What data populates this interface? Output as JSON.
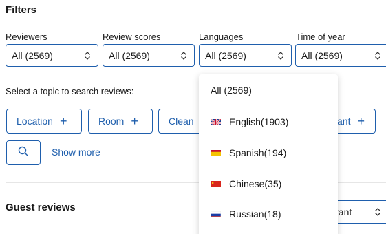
{
  "filters": {
    "title": "Filters",
    "reviewers": {
      "label": "Reviewers",
      "value": "All (2569)"
    },
    "review_scores": {
      "label": "Review scores",
      "value": "All (2569)"
    },
    "languages": {
      "label": "Languages",
      "value": "All (2569)"
    },
    "time_of_year": {
      "label": "Time of year",
      "value": "All (2569)"
    }
  },
  "topics": {
    "prompt": "Select a topic to search reviews:",
    "chips": [
      {
        "label": "Location"
      },
      {
        "label": "Room"
      },
      {
        "label": "Clean"
      },
      {
        "label": "ant"
      }
    ],
    "show_more": "Show more"
  },
  "guest_reviews": {
    "title": "Guest reviews",
    "sort_value": "evant"
  },
  "language_dropdown": {
    "options": [
      {
        "label": "All (2569)",
        "flag": null
      },
      {
        "label": "English(1903)",
        "flag": "uk-flag-icon"
      },
      {
        "label": "Spanish(194)",
        "flag": "spain-flag-icon"
      },
      {
        "label": "Chinese(35)",
        "flag": "china-flag-icon"
      },
      {
        "label": "Russian(18)",
        "flag": "russia-flag-icon"
      }
    ]
  },
  "colors": {
    "accent": "#1f5fad",
    "text": "#1a1a1a",
    "divider": "#e6e6e6"
  }
}
